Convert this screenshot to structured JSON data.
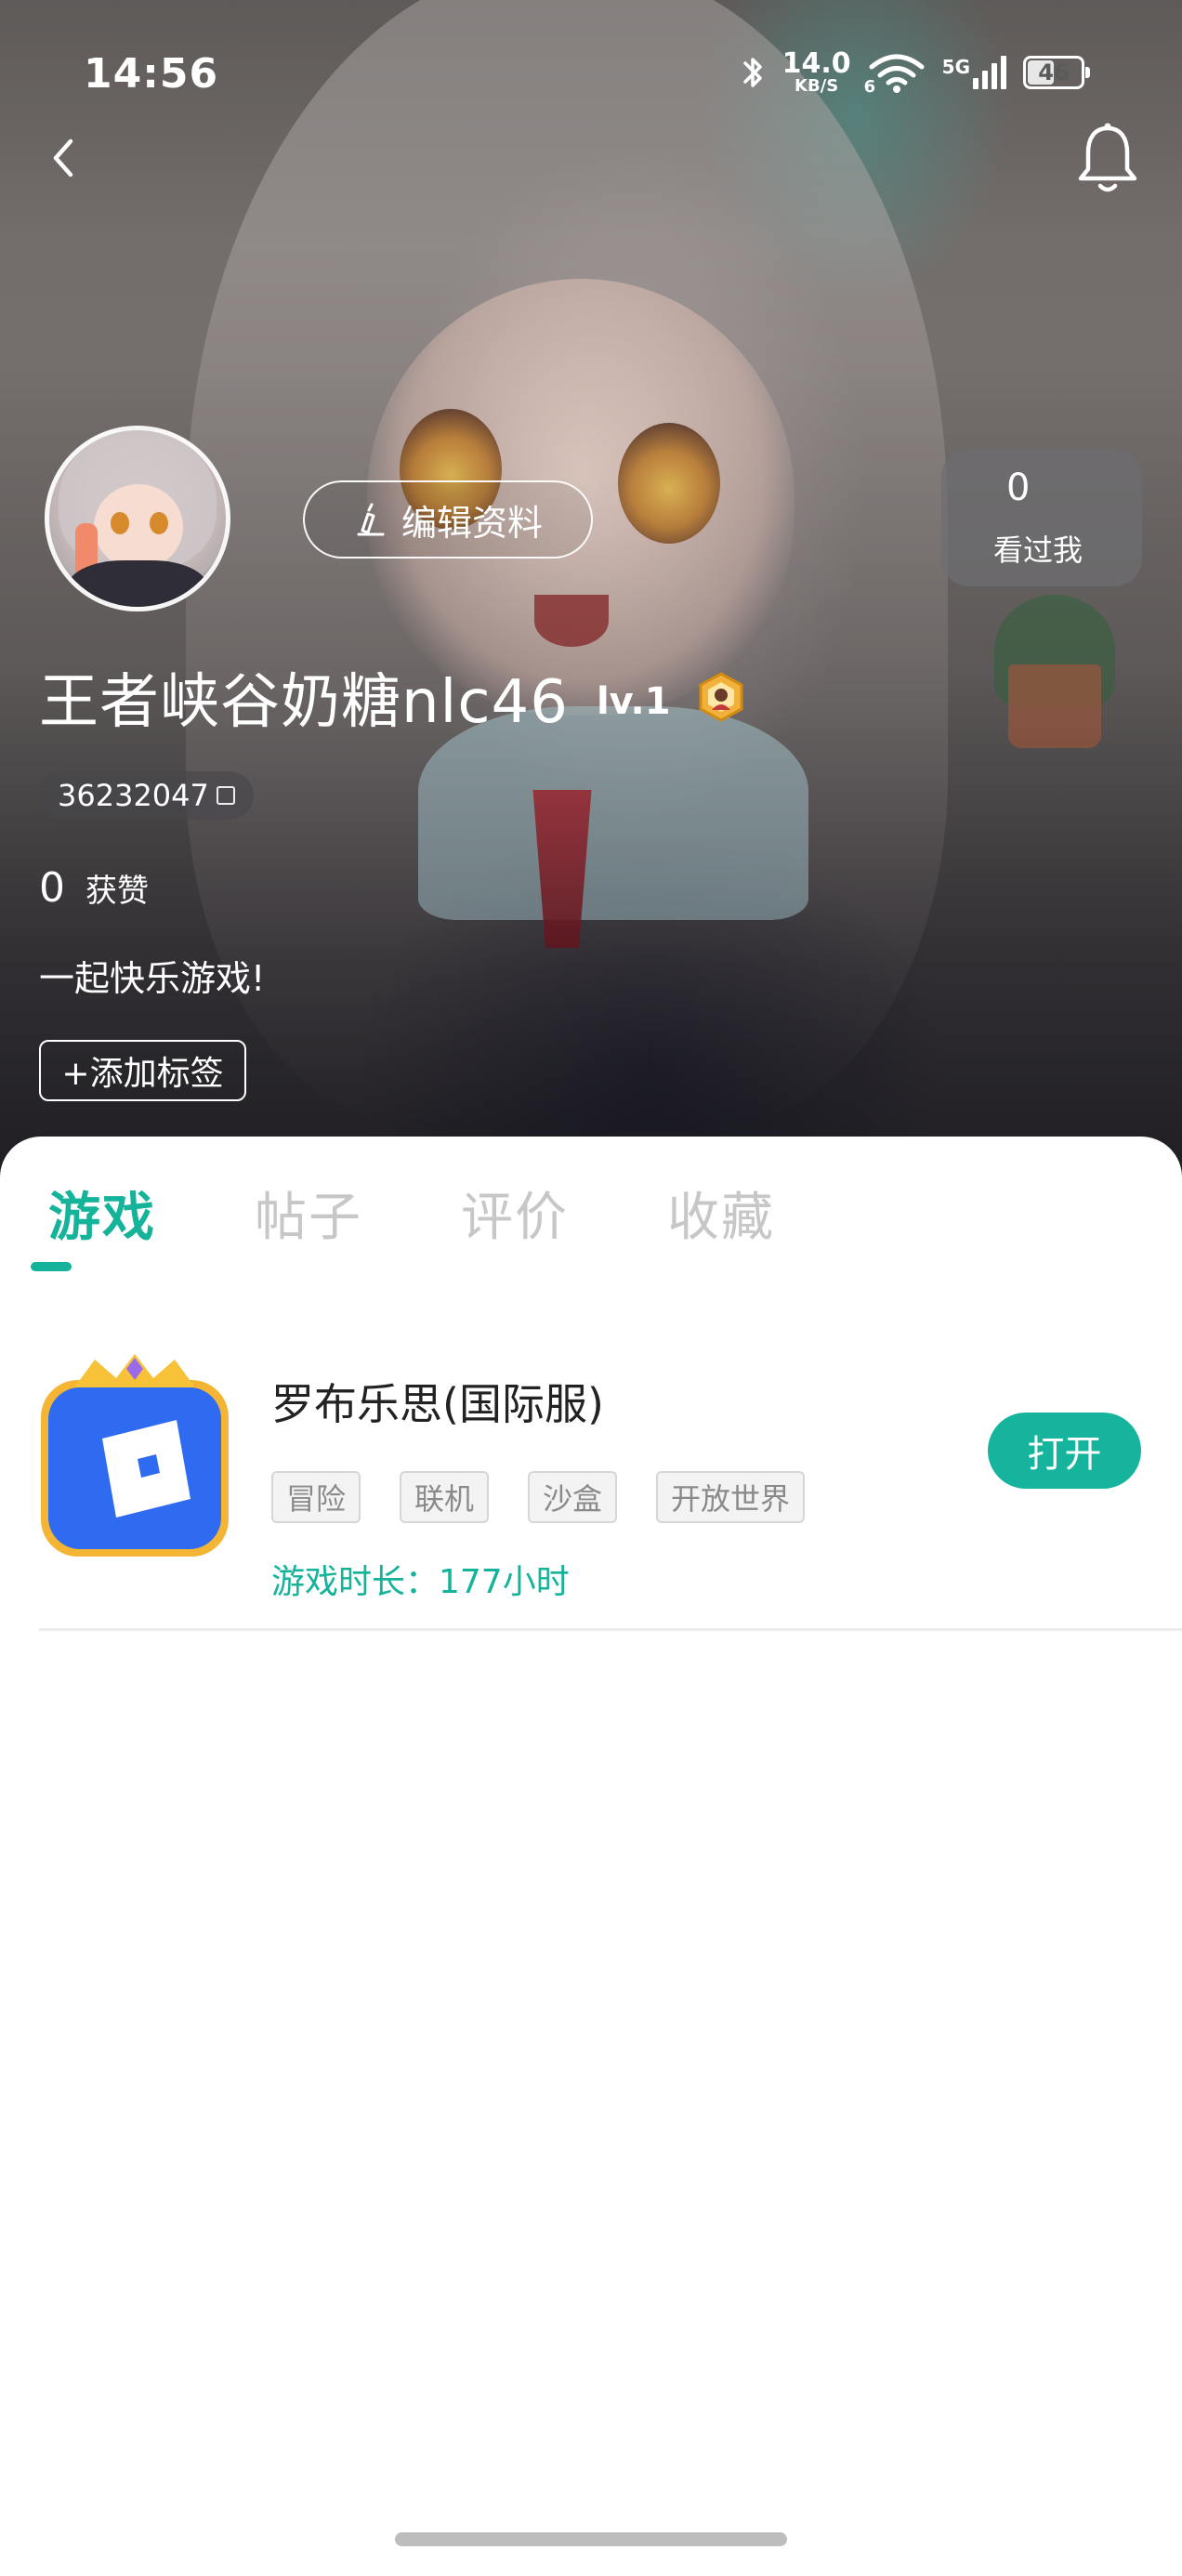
{
  "status_bar": {
    "time": "14:56",
    "net_speed_value": "14.0",
    "net_speed_unit": "KB/S",
    "wifi_badge": "6",
    "cellular_label": "5G",
    "battery_percent": "46",
    "icons": [
      "bluetooth-icon",
      "wifi-icon",
      "cellular-signal-icon",
      "battery-icon"
    ]
  },
  "nav": {
    "back_icon": "chevron-left-icon",
    "notification_icon": "bell-icon"
  },
  "profile": {
    "edit_button_label": "编辑资料",
    "visitors_count": "0",
    "visitors_label": "看过我",
    "username": "王者峡谷奶糖nlc46",
    "level": "lv.1",
    "user_id": "36232047",
    "likes_count": "0",
    "likes_label": "获赞",
    "bio": "一起快乐游戏!",
    "add_tag_label": "+添加标签"
  },
  "tabs": [
    {
      "label": "游戏",
      "active": true
    },
    {
      "label": "帖子",
      "active": false
    },
    {
      "label": "评价",
      "active": false
    },
    {
      "label": "收藏",
      "active": false
    }
  ],
  "games": [
    {
      "title": "罗布乐思(国际服)",
      "tags": [
        "冒险",
        "联机",
        "沙盒",
        "开放世界"
      ],
      "playtime": "游戏时长：177小时",
      "action_label": "打开"
    }
  ],
  "colors": {
    "accent": "#14b39a",
    "tag_text": "#8a8a8a",
    "title_text": "#222222"
  }
}
